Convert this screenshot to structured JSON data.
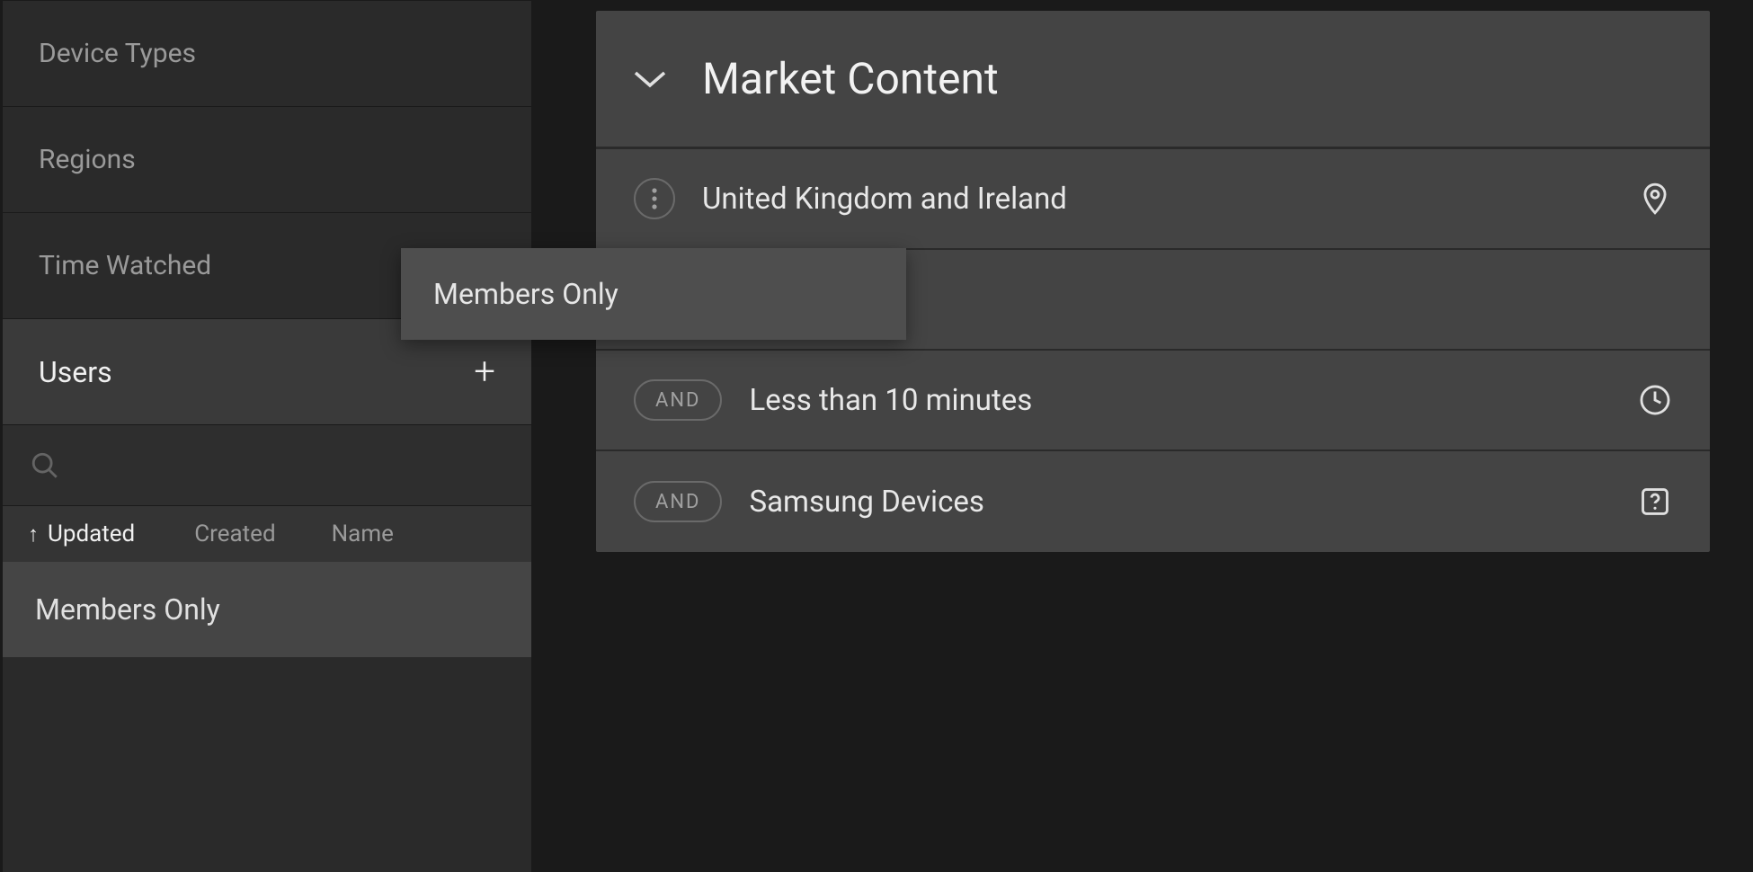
{
  "sidebar": {
    "items": [
      {
        "label": "Device Types"
      },
      {
        "label": "Regions"
      },
      {
        "label": "Time Watched"
      }
    ],
    "active_section": "Users",
    "sort_options": {
      "updated": "Updated",
      "created": "Created",
      "name": "Name"
    },
    "user_items": [
      {
        "label": "Members Only"
      }
    ]
  },
  "drag_chip": {
    "label": "Members Only"
  },
  "main": {
    "title": "Market Content",
    "rows": [
      {
        "operator": null,
        "label": "United Kingdom and Ireland",
        "icon": "pin"
      },
      {
        "operator": "AND",
        "label": "Less than 10 minutes",
        "icon": "clock"
      },
      {
        "operator": "AND",
        "label": "Samsung Devices",
        "icon": "unknown"
      }
    ]
  }
}
